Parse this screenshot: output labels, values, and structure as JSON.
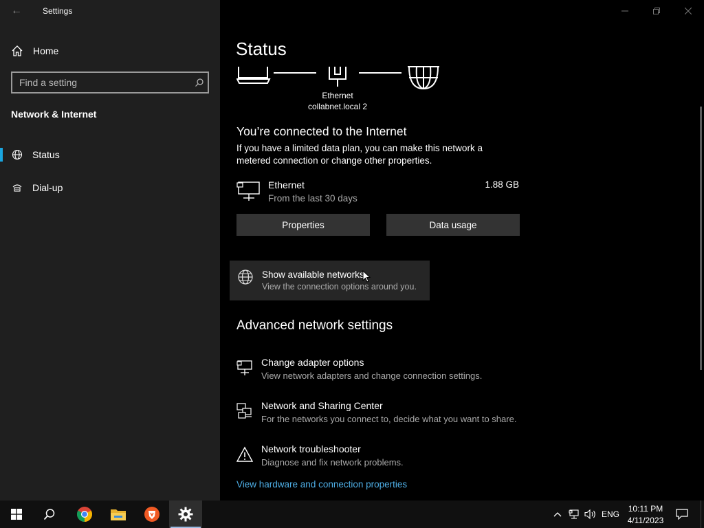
{
  "window": {
    "title": "Settings"
  },
  "sidebar": {
    "back_icon": "back-arrow-icon",
    "home": {
      "label": "Home",
      "icon": "home-icon"
    },
    "search": {
      "placeholder": "Find a setting",
      "value": "",
      "icon": "search-icon"
    },
    "section": "Network & Internet",
    "items": [
      {
        "label": "Status",
        "icon": "globe-icon",
        "selected": true
      },
      {
        "label": "Dial-up",
        "icon": "dialup-icon",
        "selected": false
      }
    ],
    "accent": "#1aa6e0"
  },
  "main": {
    "title": "Status",
    "diagram": {
      "line1": "Ethernet",
      "line2": "collabnet.local 2"
    },
    "connected_heading": "You’re connected to the Internet",
    "connected_desc": [
      "If you have a limited data plan, you can make this network a",
      "metered connection or change other properties."
    ],
    "adapter": {
      "name": "Ethernet",
      "sub": "From the last 30 days",
      "usage": "1.88 GB",
      "icon": "ethernet-pc-icon"
    },
    "buttons": {
      "properties": "Properties",
      "data_usage": "Data usage"
    },
    "show_networks": {
      "title": "Show available networks",
      "sub": "View the connection options around you.",
      "icon": "globe-icon"
    },
    "advanced": {
      "heading": "Advanced network settings",
      "items": [
        {
          "title": "Change adapter options",
          "sub": "View network adapters and change connection settings.",
          "icon": "adapter-icon"
        },
        {
          "title": "Network and Sharing Center",
          "sub": "For the networks you connect to, decide what you want to share.",
          "icon": "sharing-center-icon"
        },
        {
          "title": "Network troubleshooter",
          "sub": "Diagnose and fix network problems.",
          "icon": "warning-icon"
        }
      ],
      "link": "View hardware and connection properties"
    }
  },
  "taskbar": {
    "apps": [
      "start-icon",
      "search-icon",
      "chrome-icon",
      "file-explorer-icon",
      "brave-icon",
      "settings-gear-icon"
    ],
    "tray": {
      "language": "ENG",
      "time": "10:11 PM",
      "date": "4/11/2023"
    }
  }
}
